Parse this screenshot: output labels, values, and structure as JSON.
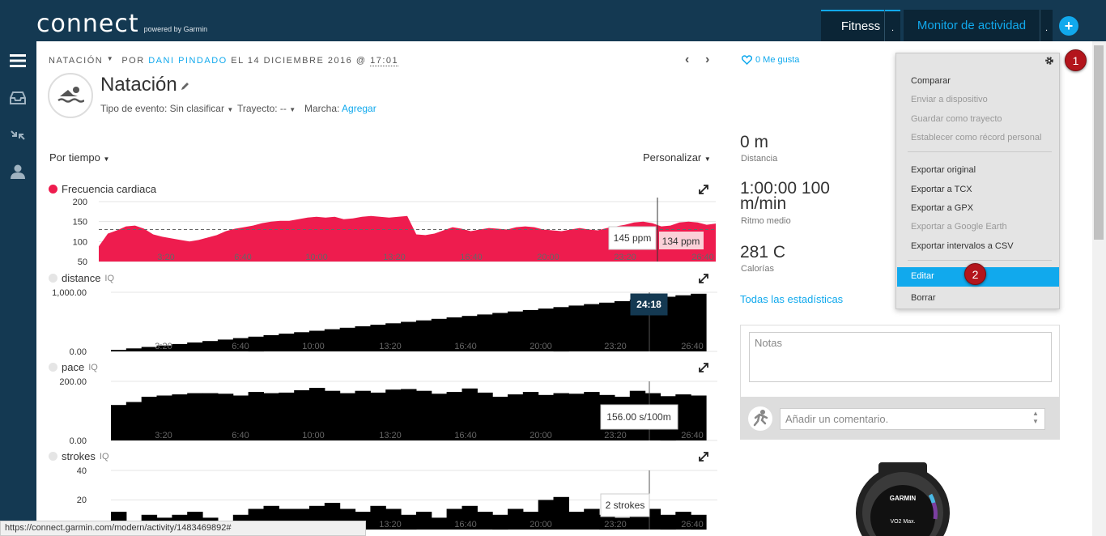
{
  "header": {
    "logo_main": "connect",
    "logo_sub": "powered by Garmin",
    "tabs": [
      {
        "label": "Fitness",
        "menu": "."
      },
      {
        "label": "Monitor de actividad",
        "menu": "."
      }
    ],
    "add_label": "+"
  },
  "activity": {
    "breadcrumb": {
      "type": "NATACIÓN",
      "by": "POR",
      "author": "DANI PINDADO",
      "date": "EL 14 DICIEMBRE 2016 @",
      "time": "17:01"
    },
    "title": "Natación",
    "event_type_label": "Tipo de evento:",
    "event_type_value": "Sin clasificar",
    "route_label": "Trayecto:",
    "route_value": "--",
    "gear_label": "Marcha:",
    "gear_value": "Agregar"
  },
  "charts_controls": {
    "by_time": "Por tiempo",
    "customize": "Personalizar"
  },
  "chart_data": [
    {
      "type": "area",
      "title": "Frecuencia cardiaca",
      "color": "#ee1c4e",
      "y_ticks": [
        "200",
        "150",
        "100",
        "50"
      ],
      "ylim": [
        50,
        200
      ],
      "x_ticks": [
        "3:20",
        "6:40",
        "10:00",
        "13:20",
        "16:40",
        "20:00",
        "23:20",
        "26:40"
      ],
      "average_line": 130,
      "tooltips": [
        "145 ppm",
        "134 ppm"
      ],
      "values": [
        88,
        120,
        128,
        138,
        140,
        132,
        118,
        112,
        108,
        104,
        100,
        104,
        110,
        116,
        126,
        132,
        136,
        140,
        146,
        150,
        152,
        152,
        156,
        160,
        162,
        160,
        162,
        156,
        158,
        162,
        164,
        162,
        160,
        162,
        164,
        118,
        116,
        120,
        128,
        136,
        132,
        126,
        130,
        134,
        132,
        130,
        136,
        138,
        136,
        130,
        128,
        126,
        130,
        134,
        130,
        128,
        134,
        138,
        142,
        148,
        150,
        146,
        138,
        140,
        148,
        150,
        148,
        142,
        145
      ]
    },
    {
      "type": "bar",
      "title": "distance",
      "iq": "IQ",
      "color": "#000000",
      "y_ticks": [
        "1,000.00",
        "0.00"
      ],
      "ylim": [
        0,
        1000
      ],
      "x_ticks": [
        "3:20",
        "6:40",
        "10:00",
        "13:20",
        "16:40",
        "20:00",
        "23:20",
        "26:40"
      ],
      "tooltips": [
        "24:18"
      ],
      "values": [
        25,
        50,
        75,
        100,
        125,
        150,
        175,
        200,
        225,
        250,
        275,
        300,
        325,
        350,
        375,
        400,
        425,
        450,
        475,
        500,
        525,
        550,
        575,
        600,
        625,
        650,
        675,
        700,
        725,
        750,
        775,
        800,
        825,
        850,
        875,
        900,
        925,
        950,
        975
      ]
    },
    {
      "type": "bar",
      "title": "pace",
      "iq": "IQ",
      "color": "#000000",
      "y_ticks": [
        "200.00",
        "0.00"
      ],
      "ylim": [
        0,
        200
      ],
      "x_ticks": [
        "3:20",
        "6:40",
        "10:00",
        "13:20",
        "16:40",
        "20:00",
        "23:20",
        "26:40"
      ],
      "tooltips": [
        "156.00 s/100m"
      ],
      "values": [
        120,
        130,
        148,
        152,
        156,
        160,
        160,
        158,
        152,
        164,
        160,
        162,
        170,
        178,
        168,
        160,
        168,
        162,
        172,
        174,
        168,
        158,
        164,
        176,
        162,
        148,
        156,
        164,
        154,
        160,
        158,
        164,
        154,
        148,
        168,
        160,
        150,
        156,
        152
      ]
    },
    {
      "type": "bar",
      "title": "strokes",
      "iq": "IQ",
      "color": "#000000",
      "y_ticks": [
        "40",
        "20"
      ],
      "ylim": [
        0,
        40
      ],
      "x_ticks": [
        "13:20",
        "16:40",
        "20:00",
        "23:20",
        "26:40"
      ],
      "tooltips": [
        "2 strokes"
      ],
      "values": [
        12,
        6,
        10,
        8,
        10,
        12,
        8,
        6,
        10,
        14,
        16,
        14,
        14,
        16,
        18,
        14,
        12,
        16,
        14,
        10,
        12,
        8,
        14,
        16,
        12,
        10,
        14,
        12,
        20,
        22,
        12,
        14,
        10,
        8,
        12,
        14,
        10,
        12,
        10
      ]
    }
  ],
  "like": {
    "label": "0 Me gusta"
  },
  "stats": [
    {
      "value": "0 m",
      "label": "Distancia"
    },
    {
      "value": "1:00:00 100 m/min",
      "label": "Ritmo medio"
    },
    {
      "value": "281 C",
      "label": "Calorías"
    }
  ],
  "all_stats_link": "Todas las estadísticas",
  "notes": {
    "placeholder": "Notas"
  },
  "comment": {
    "placeholder": "Añadir un comentario."
  },
  "watch": {
    "brand": "GARMIN",
    "screen": "VO2 Max."
  },
  "dropdown": {
    "items": [
      {
        "label": "Comparar",
        "disabled": false
      },
      {
        "label": "Enviar a dispositivo",
        "disabled": true
      },
      {
        "label": "Guardar como trayecto",
        "disabled": true
      },
      {
        "label": "Establecer como récord personal",
        "disabled": true
      },
      {
        "label": "Exportar original",
        "disabled": false
      },
      {
        "label": "Exportar a TCX",
        "disabled": false
      },
      {
        "label": "Exportar a GPX",
        "disabled": false
      },
      {
        "label": "Exportar a Google Earth",
        "disabled": true
      },
      {
        "label": "Exportar intervalos a CSV",
        "disabled": false
      },
      {
        "label": "Editar",
        "disabled": false
      },
      {
        "label": "Borrar",
        "disabled": false
      }
    ]
  },
  "badges": [
    "1",
    "2"
  ],
  "status_url": "https://connect.garmin.com/modern/activity/1483469892#"
}
